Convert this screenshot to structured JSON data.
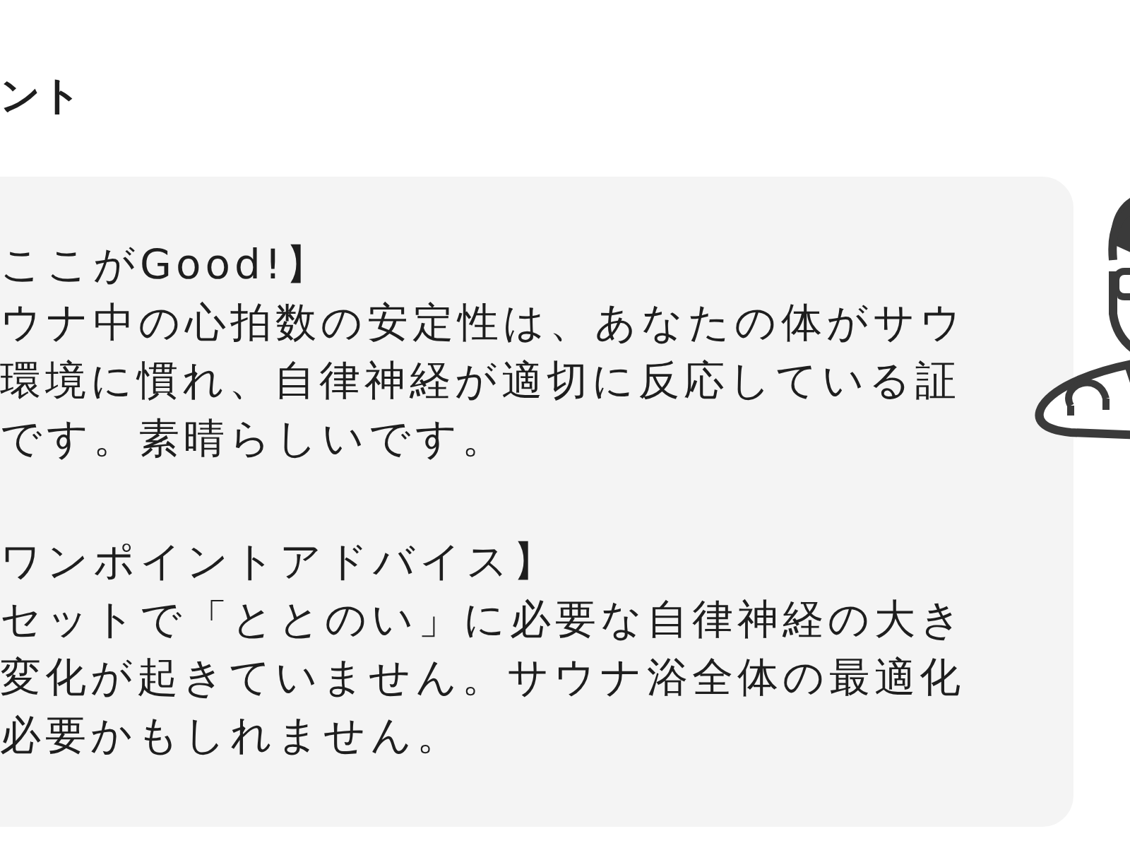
{
  "title": "ント",
  "advice_sections": [
    {
      "heading": "ここがGood!】",
      "lines": [
        "ウナ中の心拍数の安定性は、あなたの体がサウ",
        "環境に慣れ、自律神経が適切に反応している証",
        "です。素晴らしいです。"
      ]
    },
    {
      "heading": "ワンポイントアドバイス】",
      "lines": [
        "セットで「ととのい」に必要な自律神経の大き",
        "変化が起きていません。サウナ浴全体の最適化",
        "必要かもしれません。"
      ]
    }
  ]
}
